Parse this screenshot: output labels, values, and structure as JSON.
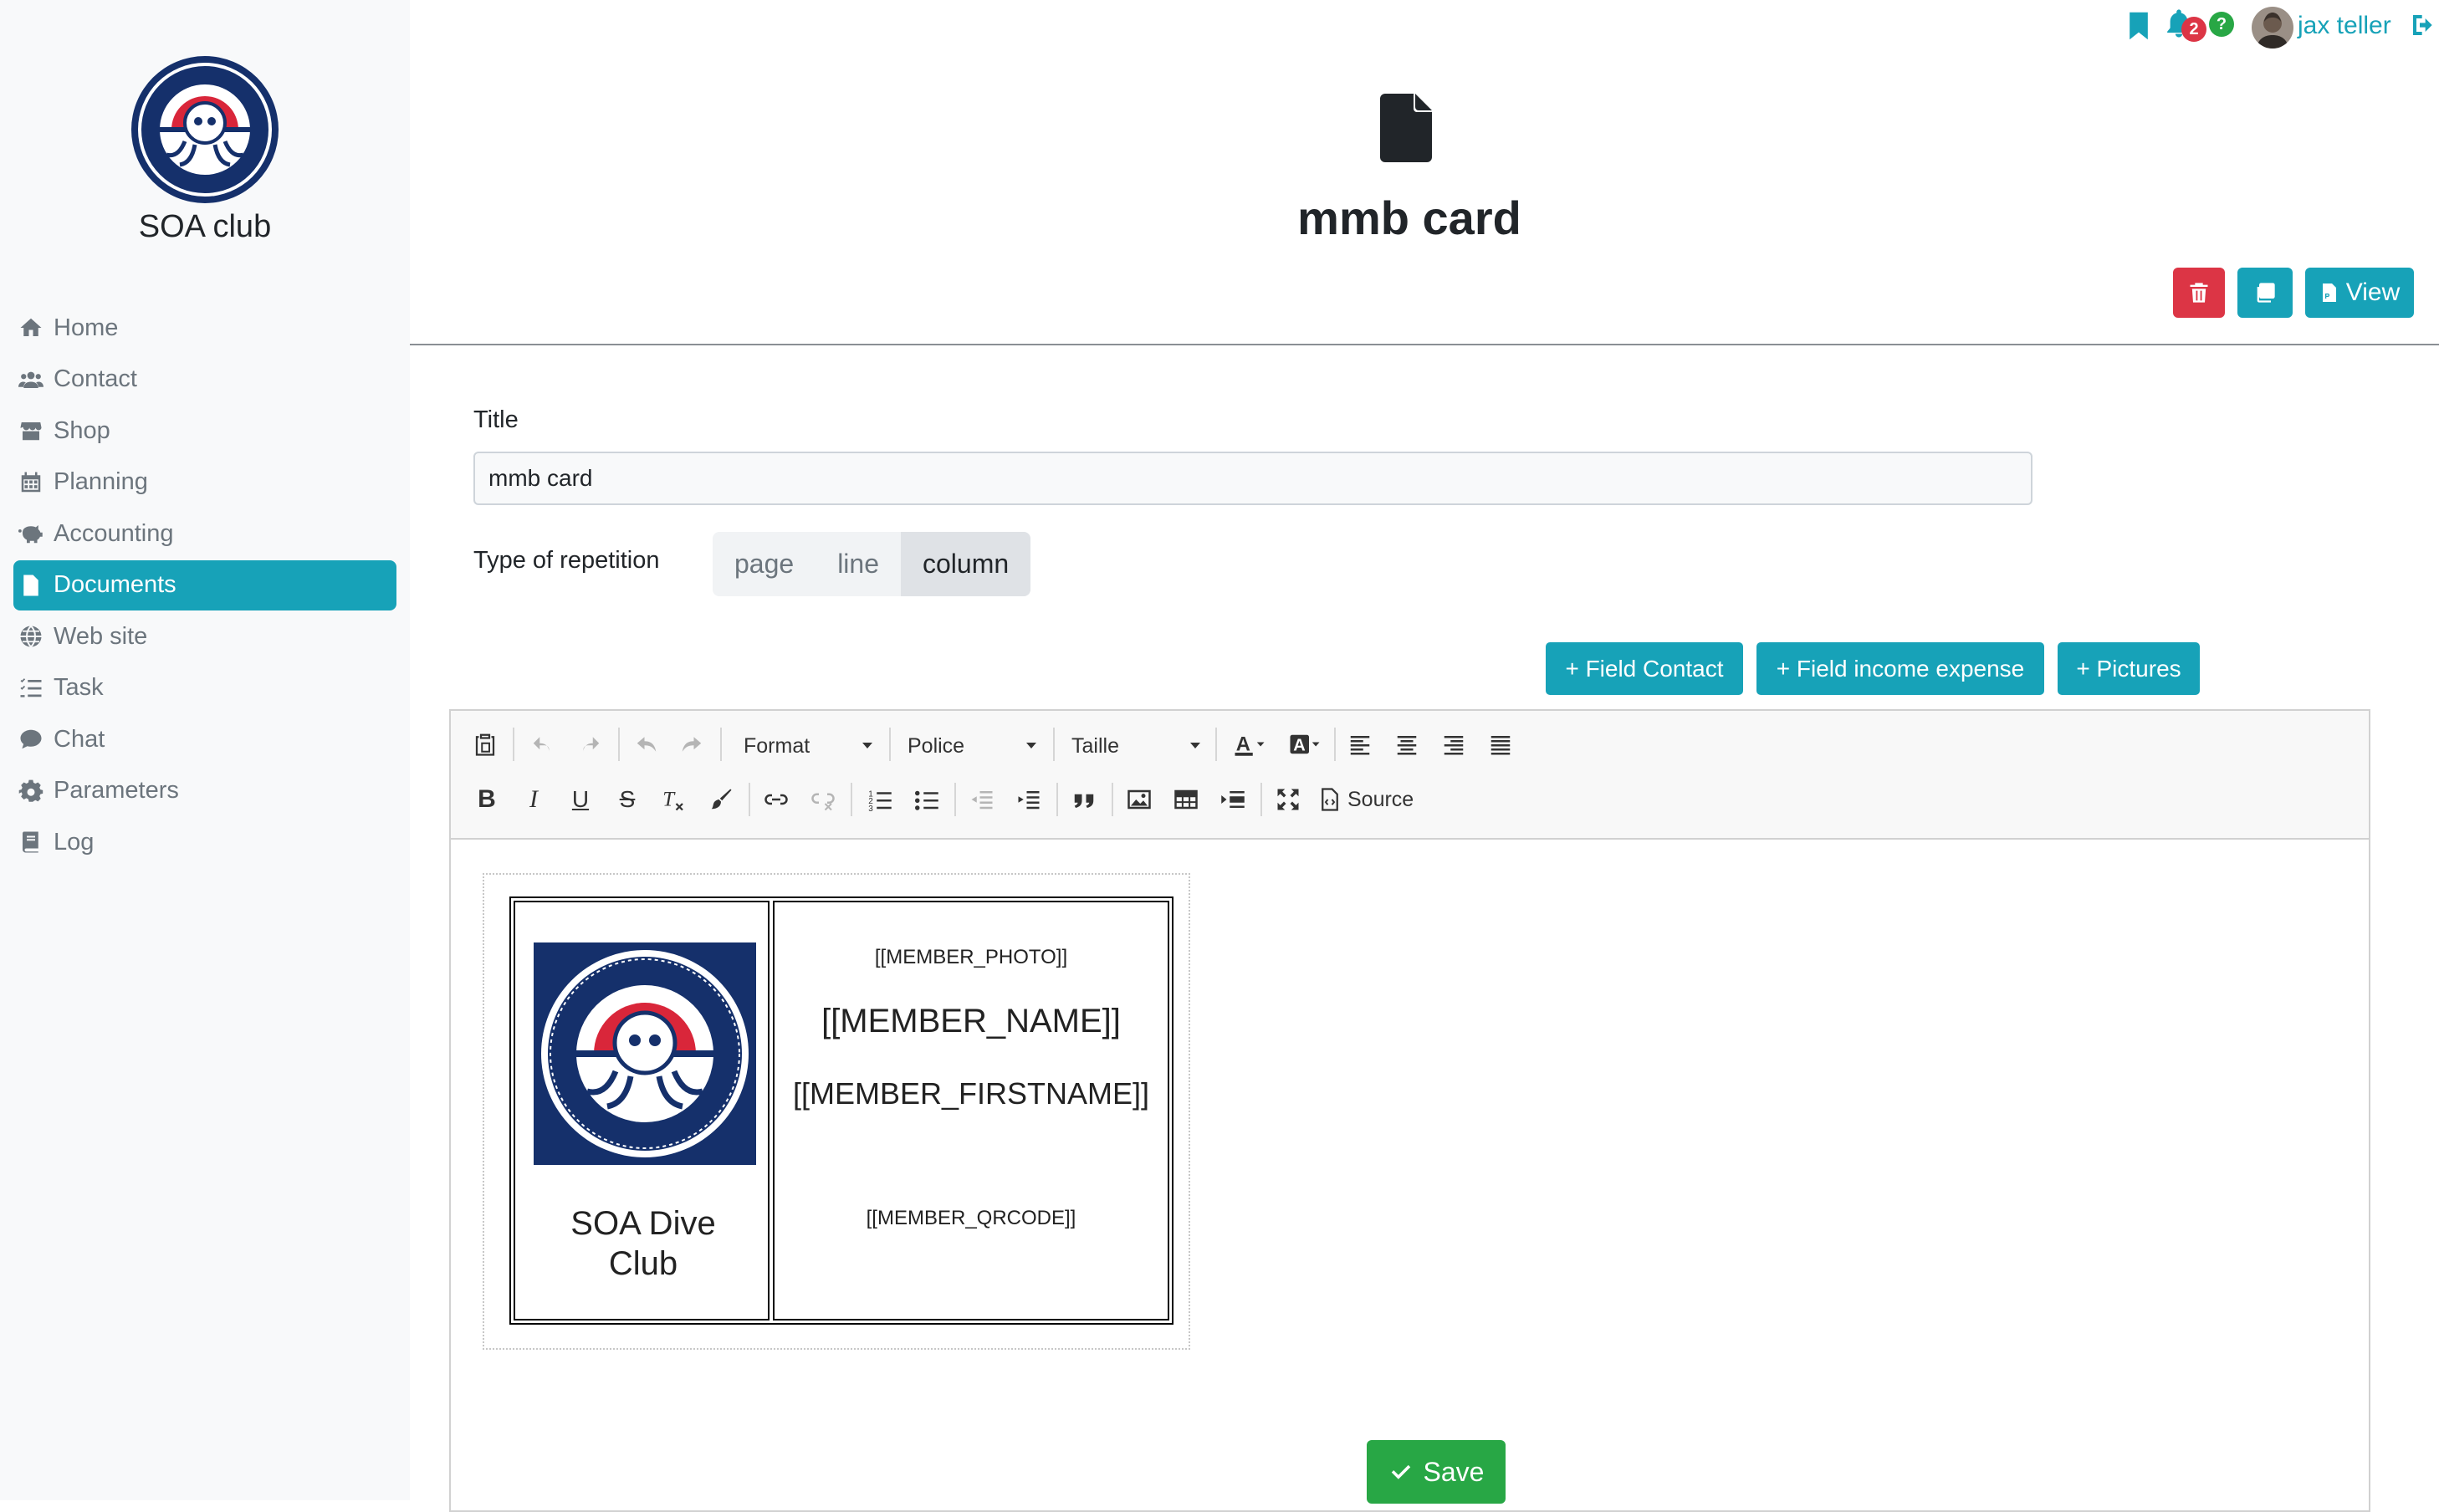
{
  "app": {
    "club_name": "SOA club"
  },
  "sidebar": {
    "items": [
      {
        "label": "Home",
        "icon": "home-icon"
      },
      {
        "label": "Contact",
        "icon": "users-icon"
      },
      {
        "label": "Shop",
        "icon": "store-icon"
      },
      {
        "label": "Planning",
        "icon": "calendar-icon"
      },
      {
        "label": "Accounting",
        "icon": "piggy-bank-icon"
      },
      {
        "label": "Documents",
        "icon": "file-icon",
        "active": true
      },
      {
        "label": "Web site",
        "icon": "globe-icon"
      },
      {
        "label": "Task",
        "icon": "tasks-icon"
      },
      {
        "label": "Chat",
        "icon": "comment-icon"
      },
      {
        "label": "Parameters",
        "icon": "gear-icon"
      },
      {
        "label": "Log",
        "icon": "book-icon"
      }
    ]
  },
  "topbar": {
    "notifications_count": "2",
    "help_badge": "?",
    "user_name": "jax teller"
  },
  "document": {
    "title": "mmb card",
    "view_label": "View"
  },
  "form": {
    "title_label": "Title",
    "title_value": "mmb card",
    "repetition_label": "Type of repetition",
    "repetition_options": [
      "page",
      "line",
      "column"
    ],
    "repetition_selected": "column",
    "insert_buttons": [
      "+ Field Contact",
      "+ Field income expense",
      "+ Pictures"
    ]
  },
  "editor": {
    "format_label": "Format",
    "font_label": "Police",
    "size_label": "Taille",
    "source_label": "Source",
    "card": {
      "club_name": "SOA Dive Club",
      "member_photo": "[[MEMBER_PHOTO]]",
      "member_name": "[[MEMBER_NAME]]",
      "member_firstname": "[[MEMBER_FIRSTNAME]]",
      "member_qrcode": "[[MEMBER_QRCODE]]"
    }
  },
  "actions": {
    "save_label": "Save"
  },
  "colors": {
    "accent": "#17a2b8",
    "danger": "#dc3545",
    "success": "#28a745",
    "notif_badge": "#dc3545",
    "help_badge": "#28a745"
  }
}
